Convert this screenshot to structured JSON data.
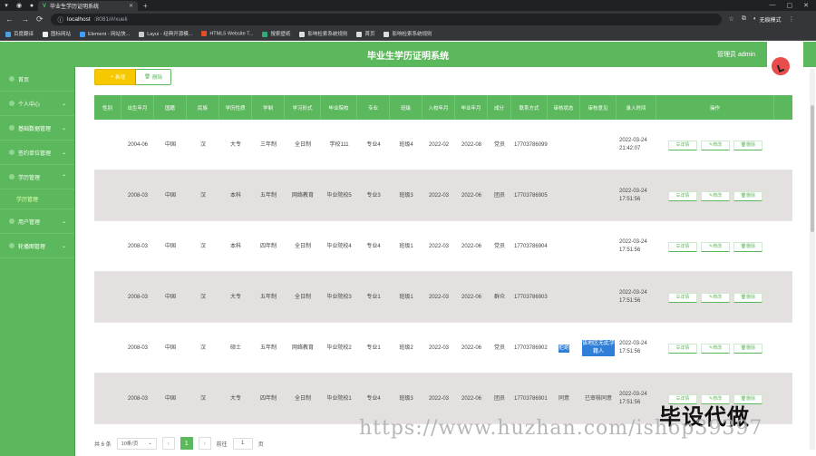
{
  "browser": {
    "tab_title": "毕业生学历证明系统",
    "url_host": "localhost",
    "url_path": ":8081/#/xueli",
    "incognito_label": "无痕模式",
    "bookmarks": [
      "百度翻译",
      "图标网站",
      "Element - 网站快...",
      "Layui - 经典开源模...",
      "HTML5 Website T...",
      "搜索壁纸",
      "影响检索系统规则",
      "首页",
      "影响检索系统规则"
    ]
  },
  "header": {
    "title": "毕业生学历证明系统",
    "admin_label": "管理员 admin"
  },
  "sidebar": {
    "items": [
      {
        "label": "首页",
        "has_children": false
      },
      {
        "label": "个人中心",
        "has_children": true
      },
      {
        "label": "基础数据管理",
        "has_children": true
      },
      {
        "label": "签约单位管理",
        "has_children": true
      },
      {
        "label": "学历管理",
        "has_children": true
      },
      {
        "label": "学历管理",
        "is_sub": true
      },
      {
        "label": "用户管理",
        "has_children": true
      },
      {
        "label": "轮播图管理",
        "has_children": true
      }
    ]
  },
  "toolbar": {
    "add_label": "新增",
    "delete_label": "删除"
  },
  "table": {
    "headers": [
      "性别",
      "出生年月",
      "国籍",
      "民族",
      "学历性质",
      "学制",
      "学习形式",
      "毕业院校",
      "专业",
      "班级",
      "入校年月",
      "毕业年月",
      "成分",
      "联系方式",
      "审核状态",
      "审核意见",
      "录入时间",
      "操作"
    ],
    "rows": [
      [
        "",
        "2004-06",
        "中国",
        "汉",
        "大专",
        "三年制",
        "全日制",
        "学校111",
        "专业4",
        "班级4",
        "2022-02",
        "2022-08",
        "党员",
        "17703786099",
        "",
        "",
        "2022-03-24 21:42:07"
      ],
      [
        "",
        "2008-03",
        "中国",
        "汉",
        "本科",
        "五年制",
        "网络教育",
        "毕业院校5",
        "专业3",
        "班级3",
        "2022-03",
        "2022-06",
        "团员",
        "17703786905",
        "",
        "",
        "2022-03-24 17:51:56"
      ],
      [
        "",
        "2008-03",
        "中国",
        "汉",
        "本科",
        "四年制",
        "全日制",
        "毕业院校4",
        "专业4",
        "班级1",
        "2022-03",
        "2022-06",
        "党员",
        "17703786904",
        "",
        "",
        "2022-03-24 17:51:56"
      ],
      [
        "",
        "2008-03",
        "中国",
        "汉",
        "大专",
        "五年制",
        "全日制",
        "毕业院校3",
        "专业1",
        "班级1",
        "2022-03",
        "2022-06",
        "群众",
        "17703786903",
        "",
        "",
        "2022-03-24 17:51:56"
      ],
      [
        "",
        "2008-03",
        "中国",
        "汉",
        "硕士",
        "五年制",
        "网络教育",
        "毕业院校2",
        "专业1",
        "班级2",
        "2022-03",
        "2022-06",
        "党员",
        "17703786902",
        "拒绝",
        "该地区无此学籍人",
        "2022-03-24 17:51:56"
      ],
      [
        "",
        "2008-03",
        "中国",
        "汉",
        "大专",
        "四年制",
        "全日制",
        "毕业院校1",
        "专业4",
        "班级3",
        "2022-03",
        "2022-06",
        "团员",
        "17703786901",
        "同意",
        "已审核同意",
        "2022-03-24 17:51:56"
      ]
    ],
    "ops": [
      "详情",
      "修改",
      "删除"
    ]
  },
  "footer": {
    "total_label": "共 6 条",
    "page_size_label": "10条/页",
    "current_page": "1",
    "goto_prefix": "前往",
    "goto_value": "1",
    "goto_suffix": "页"
  },
  "watermark": {
    "big_text": "毕设代做",
    "url_text": "https://www.huzhan.com/ishop39397"
  },
  "colors": {
    "primary": "#5cb85c",
    "add_button": "#f5c800",
    "row_alt": "#e4e0e0"
  }
}
